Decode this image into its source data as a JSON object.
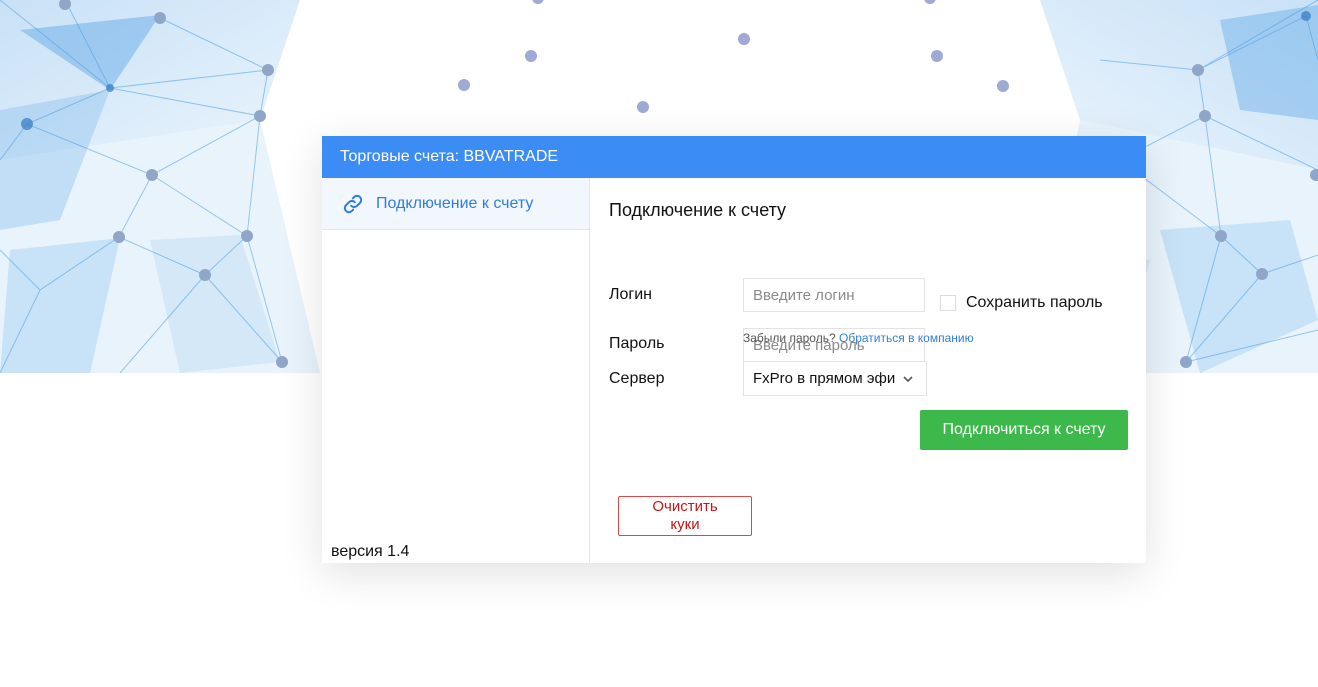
{
  "dialog": {
    "title": "Торговые счета: BBVATRADE"
  },
  "sidebar": {
    "items": [
      {
        "label": "Подключение к счету",
        "icon": "link-icon"
      }
    ],
    "version": "версия 1.4"
  },
  "form": {
    "title": "Подключение к счету",
    "login_label": "Логин",
    "login_placeholder": "Введите логин",
    "login_value": "",
    "password_label": "Пароль",
    "password_placeholder": "Введите пароль",
    "password_value": "",
    "save_password_label": "Сохранить пароль",
    "save_password_checked": false,
    "forgot_text": "Забыли пароль?",
    "forgot_link": "Обратиться в компанию",
    "server_label": "Сервер",
    "server_value": "FxPro в прямом эфире",
    "connect_button": "Подключиться к счету",
    "clear_cookies_button": "Очистить куки"
  },
  "colors": {
    "header": "#3c8cf5",
    "accent_link": "#2f7de1",
    "connect_button": "#3cb94a",
    "clear_button_text": "#c81414"
  }
}
